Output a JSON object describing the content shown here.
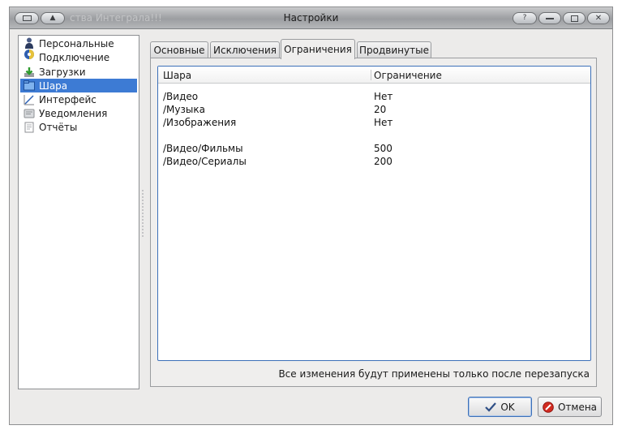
{
  "window": {
    "title": "Настройки",
    "background_app_title": "ства Интеграла!!!",
    "buttons": {
      "menu_icon": "window-menu-icon",
      "shade_icon": "shade-up-icon",
      "help_label": "?",
      "minimize_icon": "minimize-icon",
      "maximize_icon": "maximize-icon",
      "close_icon": "close-icon"
    }
  },
  "sidebar": {
    "items": [
      {
        "label": "Персональные\nПодключение",
        "icon": "person-icon"
      },
      {
        "label": "Загрузки",
        "icon": "download-icon"
      },
      {
        "label": "Шара",
        "icon": "share-folder-icon",
        "selected": true
      },
      {
        "label": "Интерфейс",
        "icon": "interface-icon"
      },
      {
        "label": "Уведомления",
        "icon": "notification-icon"
      },
      {
        "label": "Отчёты",
        "icon": "reports-icon"
      }
    ],
    "item_labels": {
      "personal": "Персональные",
      "connection": "Подключение",
      "downloads": "Загрузки",
      "share": "Шара",
      "interface": "Интерфейс",
      "notifications": "Уведомления",
      "reports": "Отчёты"
    }
  },
  "tabs": {
    "basic": "Основные",
    "exceptions": "Исключения",
    "limits": "Ограничения",
    "advanced": "Продвинутые",
    "active": "limits"
  },
  "limits_table": {
    "columns": {
      "share": "Шара",
      "limit": "Ограничение"
    },
    "rows": [
      {
        "share": "/Видео",
        "limit": "Нет"
      },
      {
        "share": "/Музыка",
        "limit": "20"
      },
      {
        "share": "/Изображения",
        "limit": "Нет"
      },
      {
        "share": "/Видео/Фильмы",
        "limit": "500"
      },
      {
        "share": "/Видео/Сериалы",
        "limit": "200"
      }
    ]
  },
  "notice": "Все изменения будут применены только после перезапуска",
  "footer": {
    "ok_label": "OK",
    "cancel_label": "Отмена"
  },
  "colors": {
    "selection": "#3d7bd4",
    "focus_border": "#3c70b8",
    "window_bg": "#ecebea"
  }
}
